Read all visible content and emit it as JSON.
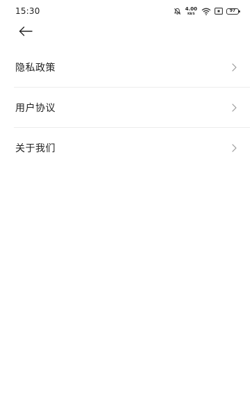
{
  "status_bar": {
    "time": "15:30",
    "icons": [
      "mute-bell-icon",
      "net-speed",
      "wifi-icon",
      "nfc-icon",
      "battery-icon"
    ],
    "net_speed_value": "4.00",
    "net_speed_unit": "KB/S",
    "battery_level": "97"
  },
  "header": {
    "back_icon": "arrow-left-icon"
  },
  "menu": {
    "items": [
      {
        "label": "隐私政策",
        "icon": "chevron-right-icon"
      },
      {
        "label": "用户协议",
        "icon": "chevron-right-icon"
      },
      {
        "label": "关于我们",
        "icon": "chevron-right-icon"
      }
    ]
  },
  "colors": {
    "background": "#ffffff",
    "text": "#222222",
    "divider": "#ececec",
    "chevron": "#9a9a9a"
  }
}
